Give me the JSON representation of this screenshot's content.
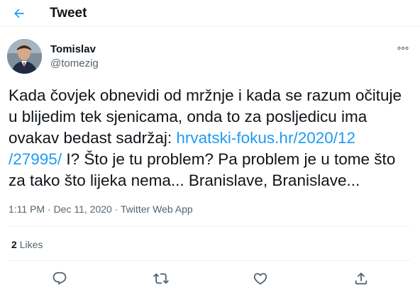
{
  "header": {
    "title": "Tweet",
    "back_icon": "arrow-left-icon"
  },
  "author": {
    "display_name": "Tomislav",
    "handle": "@tomezig"
  },
  "tweet": {
    "text_part1": "Kada čovjek obnevidi od mržnje i kada se razum očituje u blijedim tek sjenicama, onda to za posljedicu ima ovakav bedast sadržaj: ",
    "link_line1": "hrvatski-fokus.hr/2020/12",
    "link_line2": "/27995/",
    "text_part2": " I? Što je tu problem? Pa problem je u tome što za tako što lijeka nema... Branislave, Branislave..."
  },
  "meta": {
    "time": "1:11 PM",
    "sep": " · ",
    "date": "Dec 11, 2020",
    "source": "Twitter Web App"
  },
  "stats": {
    "likes_count": "2",
    "likes_label": "Likes"
  },
  "actions": [
    "reply-icon",
    "retweet-icon",
    "like-icon",
    "share-icon"
  ],
  "colors": {
    "accent": "#1d9bf0",
    "text": "#0f1419",
    "muted": "#536471",
    "border": "#eff3f4"
  }
}
